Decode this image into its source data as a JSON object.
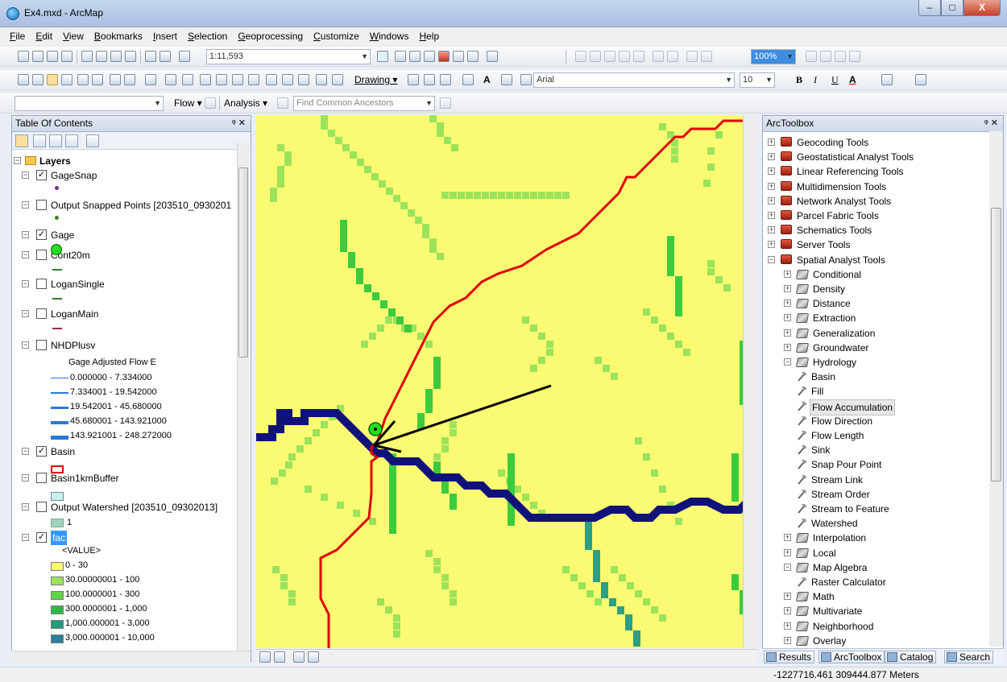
{
  "window": {
    "title": "Ex4.mxd - ArcMap",
    "min": "–",
    "max": "□",
    "close": "X"
  },
  "menu": [
    "File",
    "Edit",
    "View",
    "Bookmarks",
    "Insert",
    "Selection",
    "Geoprocessing",
    "Customize",
    "Windows",
    "Help"
  ],
  "toolbar": {
    "scale": "1:11,593",
    "drawing": "Drawing ▾",
    "font": "Arial",
    "font_size": "10",
    "bold": "B",
    "italic": "I",
    "underline": "U",
    "text_a": "A",
    "flow": "Flow ▾",
    "analysis": "Analysis ▾",
    "find_common_ancestors": "Find Common Ancestors",
    "zoom_pct": "100%"
  },
  "toc": {
    "title": "Table Of Contents",
    "pin": "ᵠ ✕",
    "root": "Layers",
    "layers": [
      {
        "name": "GageSnap",
        "checked": true
      },
      {
        "name": "Output Snapped Points [203510_0930201",
        "checked": false
      },
      {
        "name": "Gage",
        "checked": true
      },
      {
        "name": "Cont20m",
        "checked": false
      },
      {
        "name": "LoganSingle",
        "checked": false
      },
      {
        "name": "LoganMain",
        "checked": false
      },
      {
        "name": "NHDPlusv",
        "checked": false
      },
      {
        "name": "Basin",
        "checked": true
      },
      {
        "name": "Basin1kmBuffer",
        "checked": false
      },
      {
        "name": "Output Watershed [203510_09302013]",
        "checked": false
      },
      {
        "name": "fac",
        "checked": true
      }
    ],
    "nhd_field": "Gage Adjusted Flow E",
    "nhd_classes": [
      "0.000000 - 7.334000",
      "7.334001 - 19.542000",
      "19.542001 - 45.680000",
      "45.680001 - 143.921000",
      "143.921001 - 248.272000"
    ],
    "watershed_value": "1",
    "fac_field": "<VALUE>",
    "fac_classes": [
      "0 - 30",
      "30.00000001 - 100",
      "100.0000001 - 300",
      "300.0000001 - 1,000",
      "1,000.000001 - 3,000",
      "3,000.000001 - 10,000"
    ],
    "fac_colors": [
      "#fbfb73",
      "#9be35a",
      "#62d24a",
      "#2fb84a",
      "#239a7a",
      "#2b7f9a"
    ]
  },
  "toolbox": {
    "title": "ArcToolbox",
    "pin": "ᵠ ✕",
    "items": [
      {
        "label": "Geocoding Tools",
        "level": 0,
        "kind": "box",
        "exp": "+"
      },
      {
        "label": "Geostatistical Analyst Tools",
        "level": 0,
        "kind": "box",
        "exp": "+"
      },
      {
        "label": "Linear Referencing Tools",
        "level": 0,
        "kind": "box",
        "exp": "+"
      },
      {
        "label": "Multidimension Tools",
        "level": 0,
        "kind": "box",
        "exp": "+"
      },
      {
        "label": "Network Analyst Tools",
        "level": 0,
        "kind": "box",
        "exp": "+"
      },
      {
        "label": "Parcel Fabric Tools",
        "level": 0,
        "kind": "box",
        "exp": "+"
      },
      {
        "label": "Schematics Tools",
        "level": 0,
        "kind": "box",
        "exp": "+"
      },
      {
        "label": "Server Tools",
        "level": 0,
        "kind": "box",
        "exp": "+"
      },
      {
        "label": "Spatial Analyst Tools",
        "level": 0,
        "kind": "box",
        "exp": "−"
      },
      {
        "label": "Conditional",
        "level": 1,
        "kind": "set",
        "exp": "+"
      },
      {
        "label": "Density",
        "level": 1,
        "kind": "set",
        "exp": "+"
      },
      {
        "label": "Distance",
        "level": 1,
        "kind": "set",
        "exp": "+"
      },
      {
        "label": "Extraction",
        "level": 1,
        "kind": "set",
        "exp": "+"
      },
      {
        "label": "Generalization",
        "level": 1,
        "kind": "set",
        "exp": "+"
      },
      {
        "label": "Groundwater",
        "level": 1,
        "kind": "set",
        "exp": "+"
      },
      {
        "label": "Hydrology",
        "level": 1,
        "kind": "set",
        "exp": "−"
      },
      {
        "label": "Basin",
        "level": 2,
        "kind": "tool"
      },
      {
        "label": "Fill",
        "level": 2,
        "kind": "tool"
      },
      {
        "label": "Flow Accumulation",
        "level": 2,
        "kind": "tool",
        "selected": true
      },
      {
        "label": "Flow Direction",
        "level": 2,
        "kind": "tool"
      },
      {
        "label": "Flow Length",
        "level": 2,
        "kind": "tool"
      },
      {
        "label": "Sink",
        "level": 2,
        "kind": "tool"
      },
      {
        "label": "Snap Pour Point",
        "level": 2,
        "kind": "tool"
      },
      {
        "label": "Stream Link",
        "level": 2,
        "kind": "tool"
      },
      {
        "label": "Stream Order",
        "level": 2,
        "kind": "tool"
      },
      {
        "label": "Stream to Feature",
        "level": 2,
        "kind": "tool"
      },
      {
        "label": "Watershed",
        "level": 2,
        "kind": "tool"
      },
      {
        "label": "Interpolation",
        "level": 1,
        "kind": "set",
        "exp": "+"
      },
      {
        "label": "Local",
        "level": 1,
        "kind": "set",
        "exp": "+"
      },
      {
        "label": "Map Algebra",
        "level": 1,
        "kind": "set",
        "exp": "−"
      },
      {
        "label": "Raster Calculator",
        "level": 2,
        "kind": "tool"
      },
      {
        "label": "Math",
        "level": 1,
        "kind": "set",
        "exp": "+"
      },
      {
        "label": "Multivariate",
        "level": 1,
        "kind": "set",
        "exp": "+"
      },
      {
        "label": "Neighborhood",
        "level": 1,
        "kind": "set",
        "exp": "+"
      },
      {
        "label": "Overlay",
        "level": 1,
        "kind": "set",
        "exp": "+"
      }
    ]
  },
  "bottom_tabs": [
    "Results",
    "ArcToolbox",
    "Catalog",
    "Search"
  ],
  "status": {
    "coords": "-1227716.461  309444.877 Meters"
  },
  "colors": {
    "basin_outline": "#e00000",
    "stream_main": "#10127a",
    "flow_low": "#fbfb73",
    "flow_mid": "#9be35a",
    "flow_high": "#3ccb3c"
  }
}
